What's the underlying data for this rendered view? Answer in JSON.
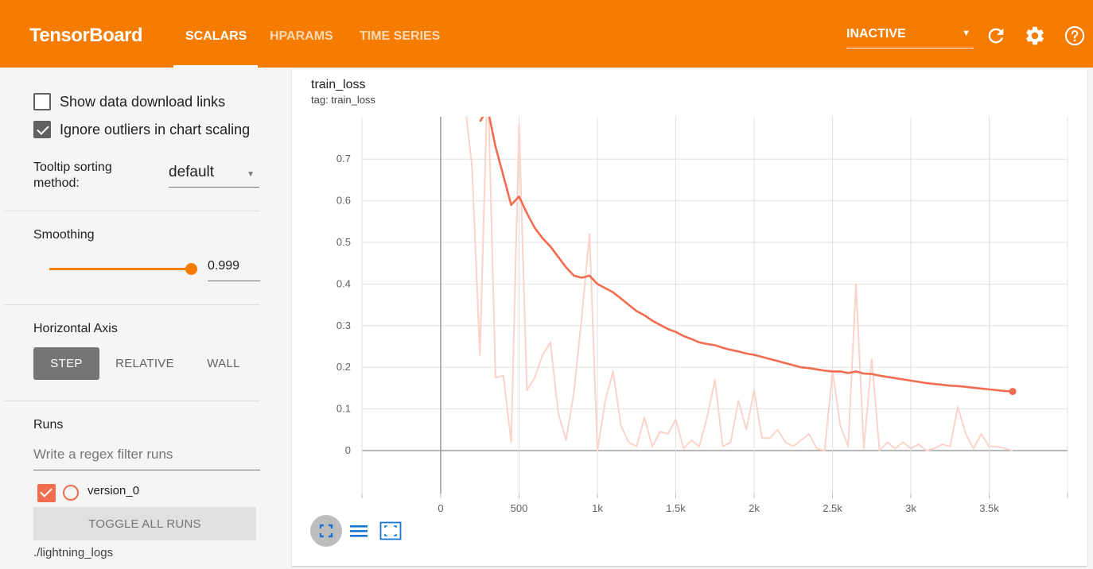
{
  "app": {
    "brand": "TensorBoard",
    "tabs": [
      {
        "label": "SCALARS",
        "active": true
      },
      {
        "label": "HPARAMS",
        "active": false
      },
      {
        "label": "TIME SERIES",
        "active": false
      }
    ],
    "status_select": "INACTIVE",
    "accent_color": "#f57c00"
  },
  "sidebar": {
    "show_download_links": {
      "label": "Show data download links",
      "checked": false
    },
    "ignore_outliers": {
      "label": "Ignore outliers in chart scaling",
      "checked": true
    },
    "tooltip_sorting": {
      "label_line1": "Tooltip sorting",
      "label_line2": "method:",
      "value": "default"
    },
    "smoothing": {
      "label": "Smoothing",
      "value": "0.999"
    },
    "horizontal_axis": {
      "label": "Horizontal Axis",
      "options": [
        "STEP",
        "RELATIVE",
        "WALL"
      ],
      "selected": "STEP"
    },
    "runs": {
      "label": "Runs",
      "filter_placeholder": "Write a regex filter runs",
      "items": [
        {
          "name": "version_0",
          "checked": true,
          "color": "#f26c4f"
        }
      ],
      "toggle_label": "TOGGLE ALL RUNS",
      "logdir": "./lightning_logs"
    }
  },
  "card": {
    "title": "train_loss",
    "tag": "tag: train_loss"
  },
  "chart_data": {
    "type": "line",
    "title": "train_loss",
    "xlabel": "",
    "ylabel": "",
    "xlim": [
      -500,
      4000
    ],
    "ylim": [
      -0.1,
      0.8
    ],
    "x_ticks": [
      0,
      500,
      1000,
      1500,
      2000,
      2500,
      3000,
      3500
    ],
    "x_tick_labels": [
      "0",
      "500",
      "1k",
      "1.5k",
      "2k",
      "2.5k",
      "3k",
      "3.5k"
    ],
    "y_ticks": [
      0,
      0.1,
      0.2,
      0.3,
      0.4,
      0.5,
      0.6,
      0.7
    ],
    "y_tick_labels": [
      "0",
      "0.1",
      "0.2",
      "0.3",
      "0.4",
      "0.5",
      "0.6",
      "0.7"
    ],
    "grid": true,
    "series": [
      {
        "name": "version_0",
        "style": "smoothed",
        "color": "#f26c4f",
        "x": [
          250,
          300,
          350,
          400,
          450,
          500,
          550,
          600,
          650,
          700,
          750,
          800,
          850,
          900,
          950,
          1000,
          1050,
          1100,
          1150,
          1200,
          1250,
          1300,
          1350,
          1400,
          1450,
          1500,
          1550,
          1600,
          1650,
          1700,
          1750,
          1800,
          1850,
          1900,
          1950,
          2000,
          2050,
          2100,
          2150,
          2200,
          2250,
          2300,
          2350,
          2400,
          2450,
          2500,
          2550,
          2600,
          2650,
          2700,
          2750,
          2800,
          2850,
          2900,
          2950,
          3000,
          3050,
          3100,
          3150,
          3200,
          3250,
          3300,
          3350,
          3400,
          3450,
          3500,
          3550,
          3600,
          3650
        ],
        "y": [
          0.79,
          0.82,
          0.73,
          0.66,
          0.59,
          0.61,
          0.57,
          0.535,
          0.51,
          0.49,
          0.465,
          0.44,
          0.42,
          0.415,
          0.42,
          0.4,
          0.39,
          0.38,
          0.365,
          0.35,
          0.335,
          0.325,
          0.312,
          0.302,
          0.292,
          0.285,
          0.275,
          0.268,
          0.26,
          0.256,
          0.253,
          0.247,
          0.242,
          0.238,
          0.233,
          0.23,
          0.225,
          0.22,
          0.215,
          0.21,
          0.205,
          0.2,
          0.198,
          0.195,
          0.192,
          0.19,
          0.19,
          0.186,
          0.19,
          0.185,
          0.184,
          0.18,
          0.177,
          0.174,
          0.171,
          0.168,
          0.165,
          0.162,
          0.16,
          0.158,
          0.156,
          0.155,
          0.153,
          0.151,
          0.149,
          0.147,
          0.145,
          0.143,
          0.142
        ]
      },
      {
        "name": "version_0",
        "style": "raw",
        "color": "#fbd3c8",
        "x": [
          150,
          200,
          250,
          300,
          350,
          400,
          450,
          500,
          550,
          600,
          650,
          700,
          750,
          800,
          850,
          900,
          950,
          1000,
          1050,
          1100,
          1150,
          1200,
          1250,
          1300,
          1350,
          1400,
          1450,
          1500,
          1550,
          1600,
          1650,
          1700,
          1750,
          1800,
          1850,
          1900,
          1950,
          2000,
          2050,
          2100,
          2150,
          2200,
          2250,
          2300,
          2350,
          2400,
          2450,
          2500,
          2550,
          2600,
          2650,
          2700,
          2750,
          2800,
          2850,
          2900,
          2950,
          3000,
          3050,
          3100,
          3150,
          3200,
          3250,
          3300,
          3350,
          3400,
          3450,
          3500,
          3550,
          3600,
          3650
        ],
        "y": [
          0.85,
          0.68,
          0.23,
          0.9,
          0.175,
          0.18,
          0.02,
          0.78,
          0.145,
          0.175,
          0.23,
          0.26,
          0.09,
          0.025,
          0.14,
          0.32,
          0.52,
          0.0,
          0.12,
          0.19,
          0.06,
          0.02,
          0.01,
          0.08,
          0.01,
          0.045,
          0.04,
          0.075,
          0.005,
          0.025,
          0.01,
          0.08,
          0.17,
          0.01,
          0.02,
          0.12,
          0.05,
          0.145,
          0.03,
          0.03,
          0.05,
          0.02,
          0.01,
          0.025,
          0.04,
          0.005,
          0.0,
          0.19,
          0.06,
          0.01,
          0.4,
          0.005,
          0.22,
          0.0,
          0.02,
          0.005,
          0.02,
          0.005,
          0.015,
          0.0,
          0.005,
          0.015,
          0.01,
          0.105,
          0.04,
          0.005,
          0.04,
          0.01,
          0.01,
          0.005,
          0.0
        ]
      }
    ]
  },
  "chart_controls": [
    {
      "icon": "fit-domain-icon"
    },
    {
      "icon": "toggle-log-scale-icon"
    },
    {
      "icon": "expand-chart-icon"
    }
  ]
}
